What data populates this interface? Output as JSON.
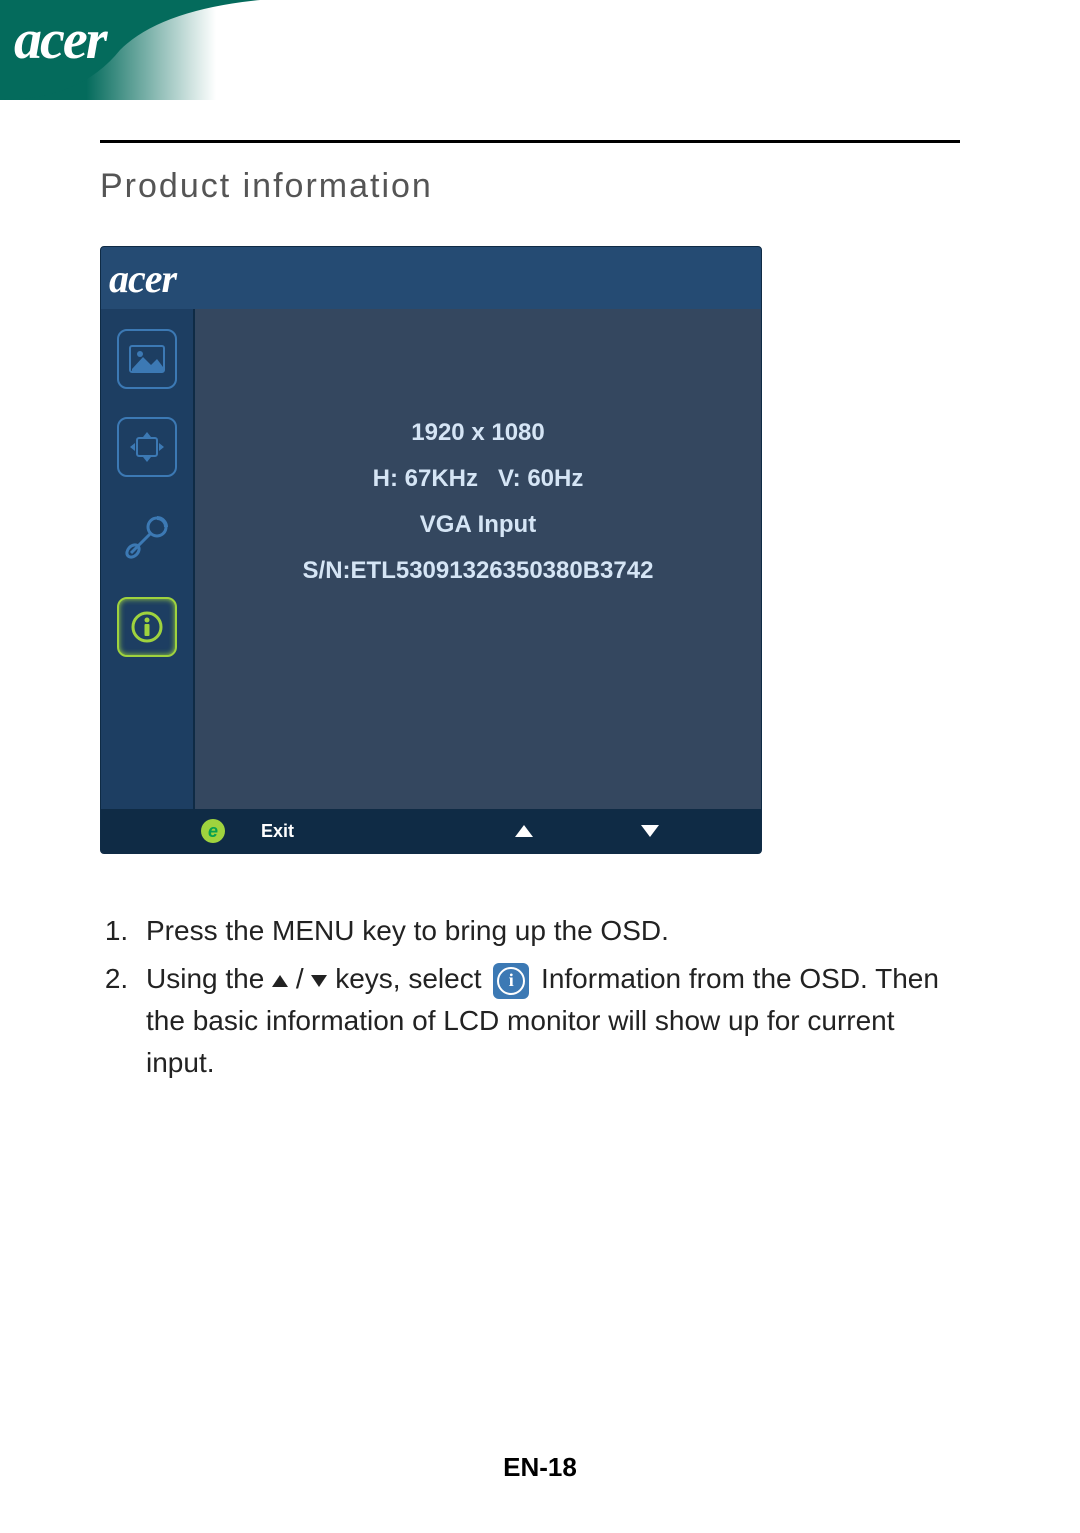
{
  "brand": "acer",
  "section_title": "Product information",
  "osd": {
    "logo": "acer",
    "info": {
      "resolution": "1920 x 1080",
      "freq": "H: 67KHz   V: 60Hz",
      "input": "VGA Input",
      "serial": "S/N:ETL53091326350380B3742"
    },
    "bar": {
      "exit": "Exit"
    }
  },
  "instructions": {
    "step1": "Press the MENU key to bring up the OSD.",
    "step2a": "Using the ",
    "step2b": " / ",
    "step2c": " keys, select ",
    "step2d": " Information from the OSD. Then the basic information of LCD monitor will show up for current input."
  },
  "page_number": "EN-18"
}
